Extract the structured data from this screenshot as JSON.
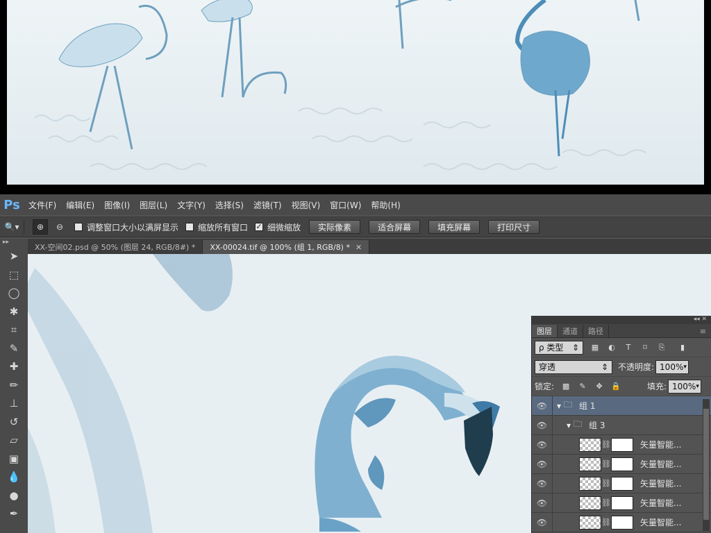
{
  "menubar": {
    "logo": "Ps",
    "items": [
      "文件(F)",
      "编辑(E)",
      "图像(I)",
      "图层(L)",
      "文字(Y)",
      "选择(S)",
      "滤镜(T)",
      "视图(V)",
      "窗口(W)",
      "帮助(H)"
    ]
  },
  "options": {
    "checkbox_resize": "调整窗口大小以满屏显示",
    "checkbox_zoom_all": "缩放所有窗口",
    "checkbox_scrubby": "细微缩放",
    "btn_actual": "实际像素",
    "btn_fit": "适合屏幕",
    "btn_fill": "填充屏幕",
    "btn_print": "打印尺寸"
  },
  "tabs": [
    {
      "label": "XX-空间02.psd @ 50% (图层 24, RGB/8#) *"
    },
    {
      "label": "XX-00024.tif @ 100% (组 1, RGB/8) *"
    }
  ],
  "layers_panel": {
    "tabs": [
      "图层",
      "通道",
      "路径"
    ],
    "filter_label": "ρ 类型",
    "blend_mode": "穿透",
    "opacity_label": "不透明度:",
    "opacity_value": "100%",
    "lock_label": "锁定:",
    "fill_label": "填充:",
    "fill_value": "100%",
    "group1": "组 1",
    "group3": "组 3",
    "layer_name": "矢量智能..."
  },
  "colors": {
    "accent": "#6ab7ff",
    "flamingo": "#5a95bd"
  }
}
